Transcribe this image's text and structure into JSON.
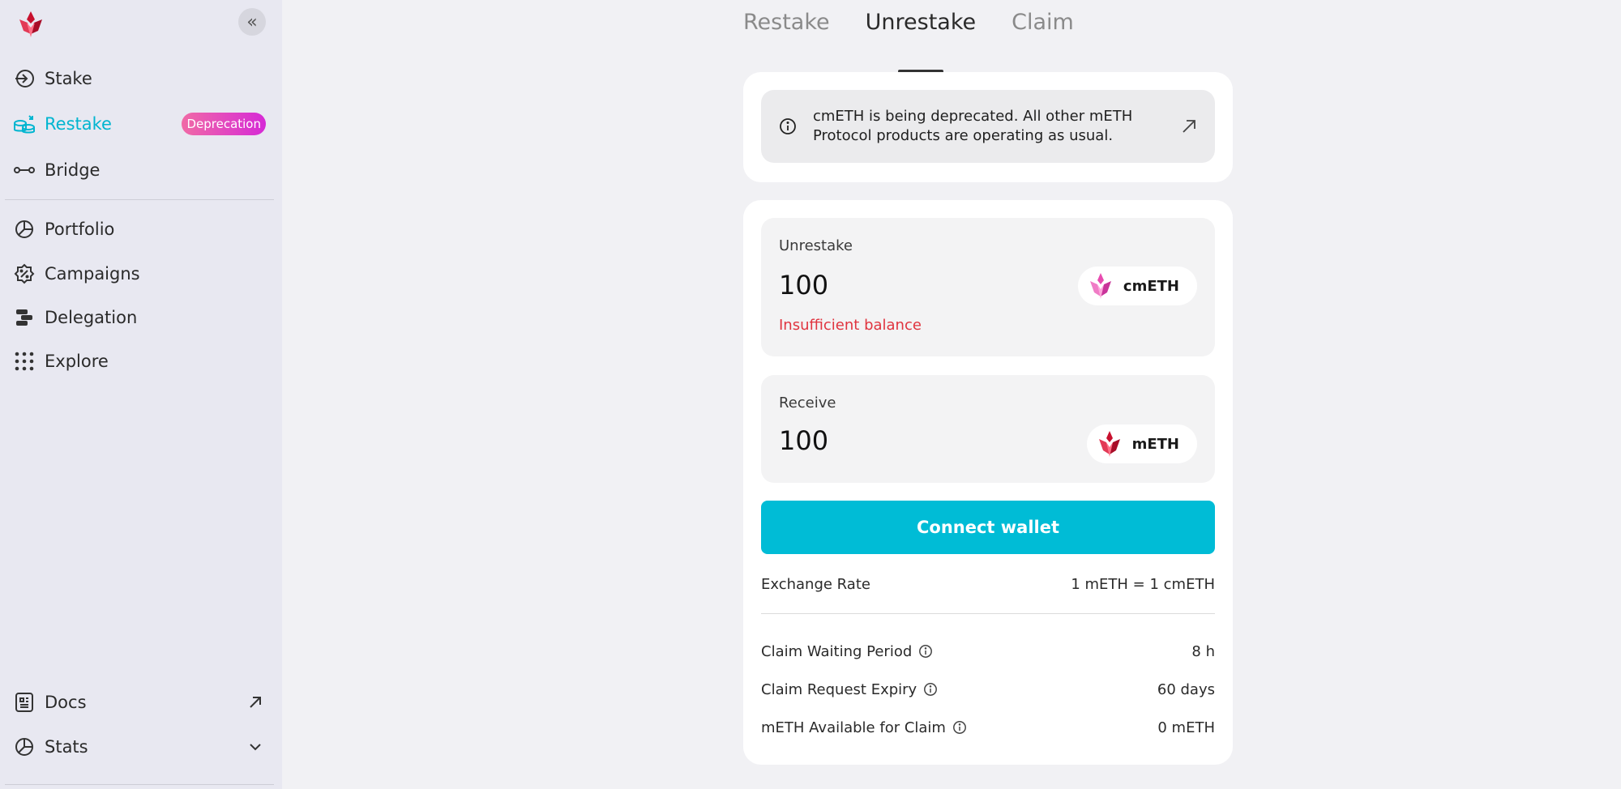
{
  "sidebar": {
    "nav": [
      {
        "label": "Stake",
        "icon": "login-arrow-icon"
      },
      {
        "label": "Restake",
        "icon": "coins-stack-icon",
        "active": true,
        "badge": "Deprecation"
      },
      {
        "label": "Bridge",
        "icon": "bridge-link-icon"
      },
      {
        "label": "Portfolio",
        "icon": "pie-chart-icon"
      },
      {
        "label": "Campaigns",
        "icon": "badge-percent-icon"
      },
      {
        "label": "Delegation",
        "icon": "delegation-icon"
      },
      {
        "label": "Explore",
        "icon": "grid-dots-icon"
      }
    ],
    "bottom": [
      {
        "label": "Docs",
        "icon": "document-icon"
      },
      {
        "label": "Stats",
        "icon": "pie-chart-icon"
      }
    ]
  },
  "tabs": [
    "Restake",
    "Unrestake",
    "Claim"
  ],
  "notice": {
    "text": "cmETH is being deprecated. All other mETH Protocol products are operating as usual."
  },
  "unrestake": {
    "label": "Unrestake",
    "amount": "100",
    "token": "cmETH",
    "error": "Insufficient balance"
  },
  "receive": {
    "label": "Receive",
    "amount": "100",
    "token": "mETH"
  },
  "connect_label": "Connect wallet",
  "details": {
    "exchange_rate": {
      "label": "Exchange Rate",
      "value": "1 mETH = 1 cmETH"
    },
    "waiting_period": {
      "label": "Claim Waiting Period",
      "value": "8 h"
    },
    "request_expiry": {
      "label": "Claim Request Expiry",
      "value": "60 days"
    },
    "available": {
      "label": "mETH Available for Claim",
      "value": "0 mETH"
    }
  },
  "colors": {
    "accent": "#00bcd6",
    "active_nav": "#00b5d0",
    "error": "#e0343f",
    "brand_red": "#c8102e",
    "cmeth_pink": "#e84bb0"
  }
}
